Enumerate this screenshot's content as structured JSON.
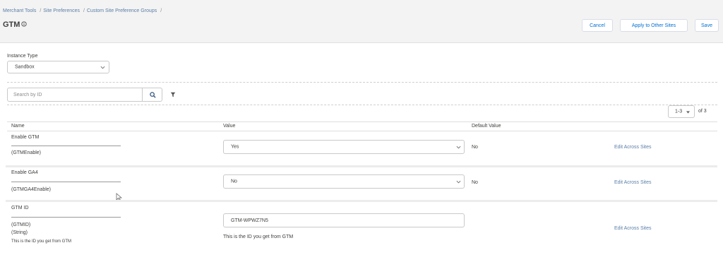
{
  "breadcrumb": {
    "items": [
      "Merchant Tools",
      "Site Preferences",
      "Custom Site Preference Groups"
    ],
    "separator": "/"
  },
  "page": {
    "title": "GTM",
    "title_icon": "info-icon"
  },
  "actions": {
    "cancel": "Cancel",
    "apply": "Apply to Other Sites",
    "save": "Save"
  },
  "instance": {
    "label": "Instance Type",
    "value": "Sandbox"
  },
  "search": {
    "placeholder": "Search by ID",
    "button_icon": "search-icon",
    "filter_icon": "filter-icon"
  },
  "pagination": {
    "range": "1-3",
    "of_label": "of 3"
  },
  "table": {
    "headers": {
      "name": "Name",
      "value": "Value",
      "default": "Default Value"
    },
    "rows": [
      {
        "name": "Enable GTM",
        "id": "(GTMEnable)",
        "value": "Yes",
        "default": "No",
        "action": "Edit Across Sites"
      },
      {
        "name": "Enable GA4",
        "id": "(GTMGA4Enable)",
        "value": "No",
        "default": "No",
        "action": "Edit Across Sites"
      },
      {
        "name": "GTM ID",
        "id": "(GTMID)",
        "type": "(String)",
        "description": "This is the ID you get from GTM",
        "value": "GTM-WPWZ7N5",
        "value_help": "This is the ID you get from GTM",
        "action": "Edit Across Sites"
      }
    ]
  },
  "colors": {
    "link": "#5b7ea8",
    "header_bg": "#f3f3f3",
    "brand": "#0070d2"
  }
}
